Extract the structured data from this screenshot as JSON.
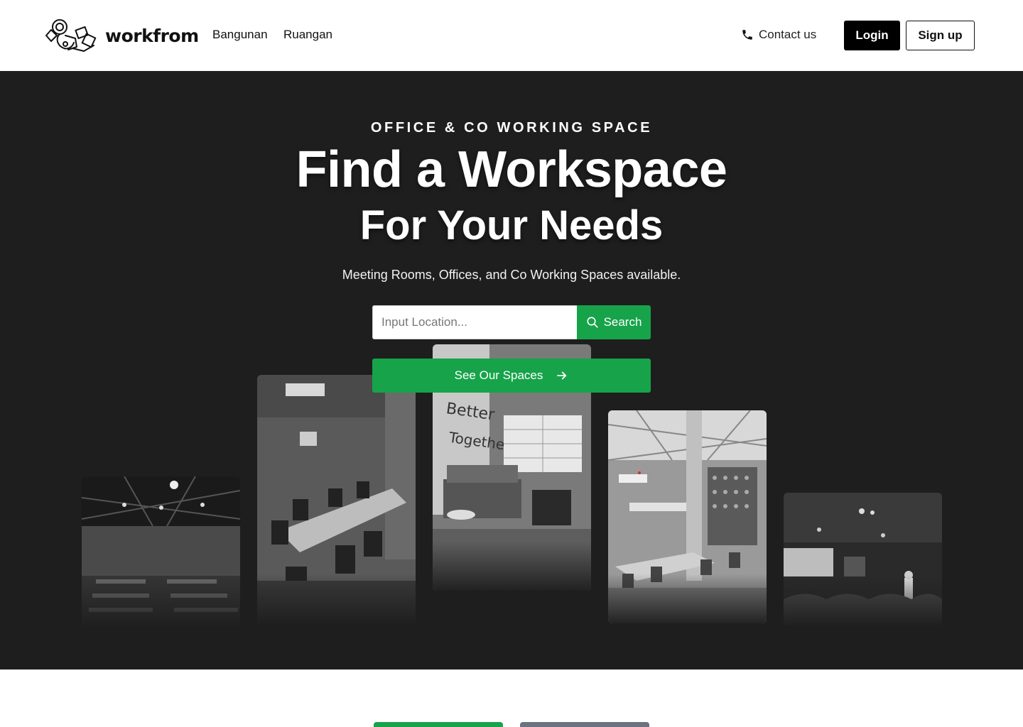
{
  "header": {
    "logo_text": "workfrom",
    "nav": [
      {
        "label": "Bangunan"
      },
      {
        "label": "Ruangan"
      }
    ],
    "contact_label": "Contact us",
    "login_label": "Login",
    "signup_label": "Sign up"
  },
  "hero": {
    "eyebrow": "OFFICE & CO WORKING SPACE",
    "title_line1": "Find a Workspace",
    "title_line2": "For Your Needs",
    "subtitle": "Meeting Rooms, Offices, and Co Working Spaces available.",
    "search": {
      "placeholder": "Input Location...",
      "value": "",
      "button_label": "Search",
      "icon": "search-icon"
    },
    "cta": {
      "label": "See Our Spaces",
      "icon": "arrow-right-icon"
    },
    "photos": [
      {
        "name": "photo-event-hall"
      },
      {
        "name": "photo-meeting-room"
      },
      {
        "name": "photo-lounge"
      },
      {
        "name": "photo-coworking-area"
      },
      {
        "name": "photo-presentation-room"
      }
    ]
  },
  "colors": {
    "accent_green": "#17a34a",
    "hero_background": "#1e1e1e",
    "secondary_gray": "#6b7280"
  }
}
